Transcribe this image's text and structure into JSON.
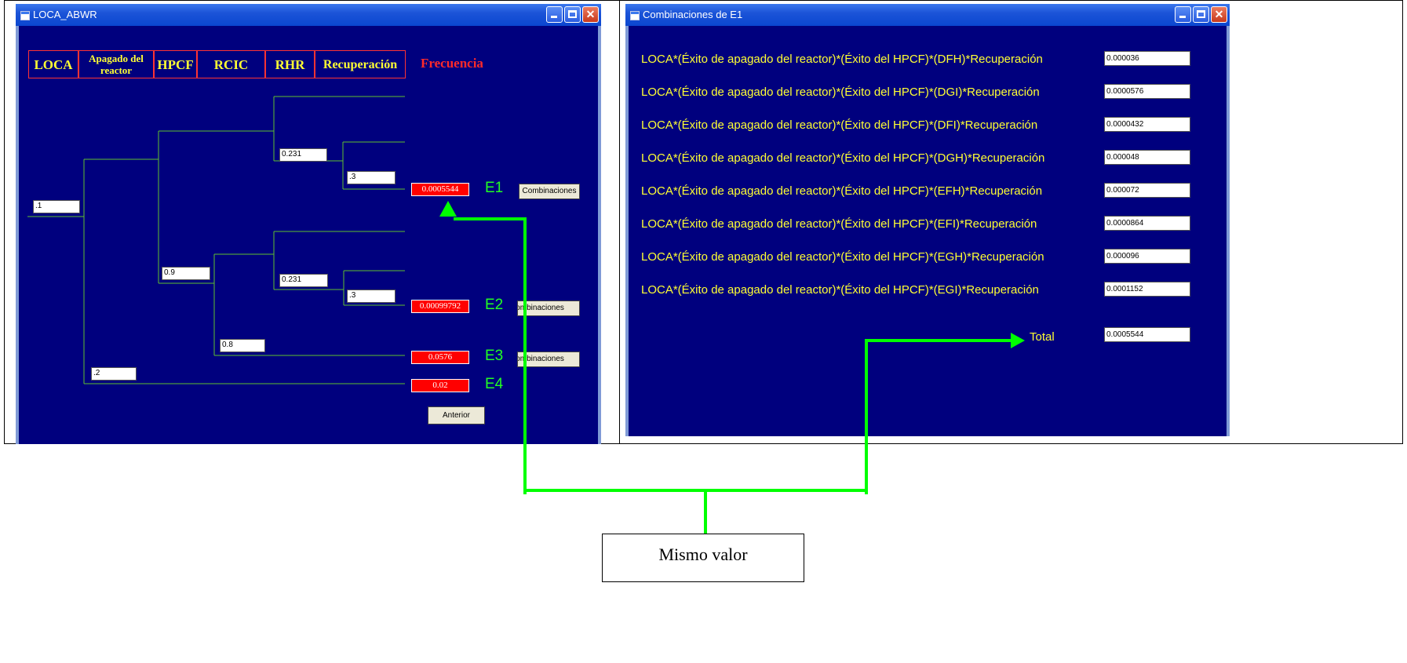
{
  "left_window": {
    "title": "LOCA_ABWR",
    "headers": [
      "LOCA",
      "Apagado del reactor",
      "HPCF",
      "RCIC",
      "RHR",
      "Recuperación"
    ],
    "frequency_header": "Frecuencia",
    "inputs": {
      "loca": ".1",
      "hpcf_upper": "0.9",
      "loca_lower": ".2",
      "rhr_upper": "0.231",
      "recup_upper": ".3",
      "rhr_lower": "0.231",
      "recup_lower": ".3",
      "rcic_lower": "0.8"
    },
    "results": [
      {
        "event": "E1",
        "value": "0.0005544",
        "button": "Combinaciones"
      },
      {
        "event": "E2",
        "value": "0.00099792",
        "button": "Combinaciones"
      },
      {
        "event": "E3",
        "value": "0.0576",
        "button": "Combinaciones"
      },
      {
        "event": "E4",
        "value": "0.02"
      }
    ],
    "previous_button": "Anterior"
  },
  "right_window": {
    "title": "Combinaciones de E1",
    "rows": [
      {
        "label": "LOCA*(Éxito de apagado del reactor)*(Éxito del HPCF)*(DFH)*Recuperación",
        "value": "0.000036"
      },
      {
        "label": "LOCA*(Éxito de apagado del reactor)*(Éxito del HPCF)*(DGI)*Recuperación",
        "value": "0.0000576"
      },
      {
        "label": "LOCA*(Éxito de apagado del reactor)*(Éxito del HPCF)*(DFI)*Recuperación",
        "value": "0.0000432"
      },
      {
        "label": "LOCA*(Éxito de apagado del reactor)*(Éxito del HPCF)*(DGH)*Recuperación",
        "value": "0.000048"
      },
      {
        "label": "LOCA*(Éxito de apagado del reactor)*(Éxito del HPCF)*(EFH)*Recuperación",
        "value": "0.000072"
      },
      {
        "label": "LOCA*(Éxito de apagado del reactor)*(Éxito del HPCF)*(EFI)*Recuperación",
        "value": "0.0000864"
      },
      {
        "label": "LOCA*(Éxito de apagado del reactor)*(Éxito del HPCF)*(EGH)*Recuperación",
        "value": "0.000096"
      },
      {
        "label": "LOCA*(Éxito de apagado del reactor)*(Éxito del HPCF)*(EGI)*Recuperación",
        "value": "0.0001152"
      }
    ],
    "total_label": "Total",
    "total_value": "0.0005544"
  },
  "annotation": {
    "text": "Mismo valor",
    "arrow_color": "#00ff00"
  },
  "colors": {
    "client_bg": "#00007e",
    "label_yellow": "#ffff33",
    "freq_red": "#ff2a2a",
    "result_red": "#ff0000",
    "event_green": "#22ff22"
  }
}
